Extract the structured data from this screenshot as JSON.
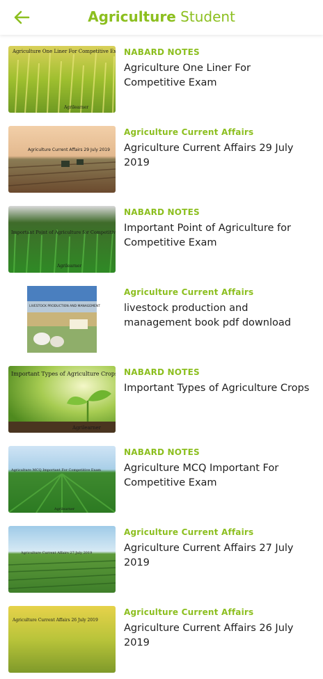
{
  "header": {
    "title_bold": "Agriculture",
    "title_rest": " Student",
    "back_icon": "arrow-left-icon",
    "accent": "#8cbf1f"
  },
  "items": [
    {
      "category": "NABARD NOTES",
      "title": "Agriculture One Liner For Competitive Exam",
      "thumb_text": "Agriculture One Liner For Competitive Exam",
      "thumb_brand": "Agrilearner"
    },
    {
      "category": "Agriculture Current Affairs",
      "title": "Agriculture Current Affairs 29 July 2019",
      "thumb_text": "Agriculture Current Affairs 29 July 2019",
      "thumb_brand": ""
    },
    {
      "category": "NABARD NOTES",
      "title": "Important Point of Agriculture for Competitive Exam",
      "thumb_text": "Important Point of Agriculture for Competitive Exam",
      "thumb_brand": "Agrilearner"
    },
    {
      "category": "Agriculture Current Affairs",
      "title": "livestock production and management book pdf download",
      "thumb_text": "LIVESTOCK PRODUCTION AND MANAGEMENT",
      "thumb_brand": ""
    },
    {
      "category": "NABARD NOTES",
      "title": "Important Types of Agriculture Crops",
      "thumb_text": "Important Types of Agriculture Crops",
      "thumb_brand": "Agrilearner"
    },
    {
      "category": "NABARD NOTES",
      "title": "Agriculture MCQ Important For Competitive Exam",
      "thumb_text": "Agriculture MCQ Important For Competitive Exam",
      "thumb_brand": "Agrilearner"
    },
    {
      "category": "Agriculture Current Affairs",
      "title": "Agriculture Current Affairs 27 July 2019",
      "thumb_text": "Agriculture Current Affairs 27 July 2019",
      "thumb_brand": ""
    },
    {
      "category": "Agriculture Current Affairs",
      "title": "Agriculture Current Affairs 26 July 2019",
      "thumb_text": "Agriculture Current Affairs 26 July 2019",
      "thumb_brand": ""
    }
  ]
}
